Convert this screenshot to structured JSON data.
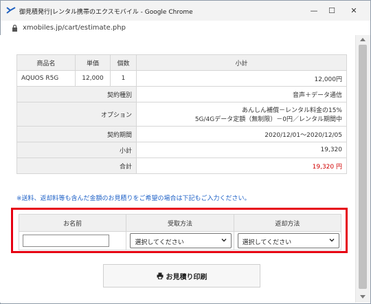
{
  "window": {
    "title": "御見積発行|レンタル携帯のエクスモバイル - Google Chrome",
    "url": "xmobiles.jp/cart/estimate.php",
    "controls": [
      "—",
      "☐",
      "✕"
    ]
  },
  "estimate": {
    "headers": [
      "商品名",
      "単価",
      "個数",
      "小計"
    ],
    "item": {
      "name": "AQUOS R5G",
      "price": "12,000",
      "qty": "1",
      "subtotal": "12,000円"
    },
    "rows": [
      {
        "label": "契約種別",
        "value": "音声＋データ通信"
      },
      {
        "label": "オプション",
        "value_line1": "あんしん補償－レンタル料金の15%",
        "value_line2": "5G/4Gデータ定額（無制限）－0円／レンタル期間中"
      },
      {
        "label": "契約期間",
        "value": "2020/12/01～2020/12/05"
      },
      {
        "label": "小計",
        "value": "19,320"
      },
      {
        "label": "合計",
        "value": "19,320 円"
      }
    ],
    "total_color": "#d00000"
  },
  "notice": "※送料、返却料等も含んだ金額のお見積りをご希望の場合は下記もご入力ください。",
  "form": {
    "headers": [
      "お名前",
      "受取方法",
      "返却方法"
    ],
    "name_value": "",
    "receive_selected": "選択してください",
    "return_selected": "選択してください",
    "highlight_color": "#e60012"
  },
  "print_button": {
    "label": "お見積り印刷",
    "icon": "printer-icon"
  }
}
